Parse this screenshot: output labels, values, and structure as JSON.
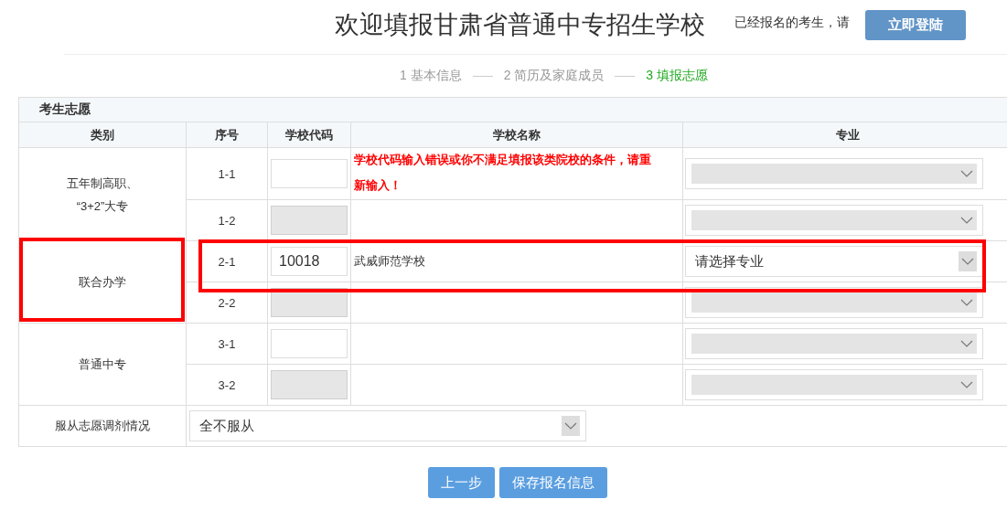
{
  "header": {
    "title": "欢迎填报甘肃省普通中专招生学校",
    "login_prompt": "已经报名的考生，请",
    "login_button": "立即登陆"
  },
  "steps": [
    {
      "label": "1 基本信息",
      "selected": false
    },
    {
      "label": "2 简历及家庭成员",
      "selected": false
    },
    {
      "label": "3 填报志愿",
      "selected": true
    }
  ],
  "section_title": "考生志愿",
  "columns": [
    "类别",
    "序号",
    "学校代码",
    "学校名称",
    "专业"
  ],
  "groups": [
    {
      "category": "五年制高职、\n“3+2”大专",
      "highlighted": false,
      "rows": [
        {
          "seq": "1-1",
          "code": "",
          "disabled": false,
          "school": "",
          "error": "学校代码输入错误或你不满足填报该类院校的条件，请重新输入！",
          "major": "",
          "highlighted": false
        },
        {
          "seq": "1-2",
          "code": "",
          "disabled": true,
          "school": "",
          "major": "",
          "highlighted": false
        }
      ]
    },
    {
      "category": "联合办学",
      "highlighted": true,
      "rows": [
        {
          "seq": "2-1",
          "code": "10018",
          "disabled": false,
          "school": "武威师范学校",
          "major": "请选择专业",
          "highlighted": true
        },
        {
          "seq": "2-2",
          "code": "",
          "disabled": true,
          "school": "",
          "major": "",
          "highlighted": false
        }
      ]
    },
    {
      "category": "普通中专",
      "highlighted": false,
      "rows": [
        {
          "seq": "3-1",
          "code": "",
          "disabled": false,
          "school": "",
          "major": "",
          "highlighted": false
        },
        {
          "seq": "3-2",
          "code": "",
          "disabled": true,
          "school": "",
          "major": "",
          "highlighted": false
        }
      ]
    }
  ],
  "adjustment": {
    "label": "服从志愿调剂情况",
    "value": "全不服从"
  },
  "buttons": [
    "上一步",
    "保存报名信息"
  ]
}
